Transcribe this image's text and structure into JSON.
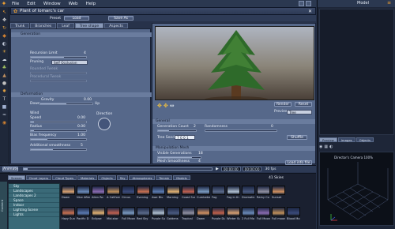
{
  "menubar": {
    "items": [
      "File",
      "Edit",
      "Window",
      "Web",
      "Help"
    ]
  },
  "window": {
    "title": "Plant of lomarc's car",
    "model_label": "Model"
  },
  "preset": {
    "label": "Preset",
    "load": "Load",
    "save_as": "Save As"
  },
  "tabs": [
    "Trunk",
    "Branches",
    "Leaf",
    "Tree shape",
    "Aspects"
  ],
  "active_tab": "Tree shape",
  "generation": {
    "header": "Generation",
    "recursion_label": "Recursion Limit",
    "recursion_value": "4",
    "pruning_label": "Pruning",
    "pruning_value": "Self Occlusion",
    "rounded_label": "Rounded Tweak",
    "rounded_value": "",
    "procedural_label": "Procedural Tweak",
    "procedural_value": ""
  },
  "deformation": {
    "header": "Deformation",
    "gravity_label": "Gravity",
    "gravity_value": "0.00",
    "down_label": "Down",
    "up_label": "Up",
    "wind_label": "Wind",
    "direction_label": "Direction",
    "speed_label": "Speed",
    "speed_value": "0.00",
    "radius_label": "Radius",
    "radius_value": "0.00",
    "bias_label": "Bias frequency",
    "bias_value": "1.00",
    "additional_label": "Additional smoothness",
    "additional_value": "5"
  },
  "preview": {
    "render_label": "Render",
    "reset_label": "Reset",
    "preview_label": "Preview",
    "preview_value": "Tree",
    "general_header": "General",
    "gen_count_label": "Generation Count",
    "gen_count_value": "2",
    "randomness_label": "Randomness",
    "randomness_value": "0",
    "tree_seed_label": "Tree Seed",
    "tree_seed_value": "7 0 0 1",
    "shuffle_label": "Shuffle",
    "manip_header": "Manipulation Mesh",
    "visible_gen_label": "Visible Generations",
    "visible_gen_value": "18",
    "mesh_label": "Mesh Smoothness",
    "mesh_value": "4",
    "load_info_label": "Load info file"
  },
  "timeline": {
    "animate_label": "Animate",
    "time_start": "00:00:00",
    "time_end": "00:00:00",
    "fps_label": "30 fps"
  },
  "browser": {
    "tabs": [
      "Scenes",
      "Cloud Layers",
      "Cloud Types",
      "Materials",
      "Objects",
      "Sky",
      "Atmospheres",
      "Terrain",
      "Models"
    ],
    "count_label": "41 Skies",
    "categories": [
      "Sky",
      "Landscapes",
      "Landscapes 2",
      "Space",
      "Indoor",
      "Lighting Scene",
      "Lights"
    ],
    "thumbs_row1": [
      "Dawn",
      "Nice After",
      "Alien Ro",
      "A California",
      "Circus",
      "Evening",
      "Awe Blu",
      "Morning",
      "Coast Sun",
      "Cumbetem",
      "Fog",
      "Fog in th",
      "Dramatic",
      "Rainy Co",
      "Sunset"
    ],
    "thumbs_row2": [
      "Hazy Sun",
      "Pacific D",
      "Eclipse",
      "Mid-stor",
      "Full Moon",
      "Red Sky",
      "Purple Su",
      "Goldens",
      "Tropical",
      "Dawn",
      "Purple Du",
      "Winter Su",
      "2 Full Mo",
      "Full Moon",
      "Full moon",
      "Blood Mo"
    ]
  },
  "right_sidebar": {
    "tabs": [
      "Preview",
      "Images",
      "Objects"
    ],
    "camera_label": "Director's Camera 100%"
  }
}
